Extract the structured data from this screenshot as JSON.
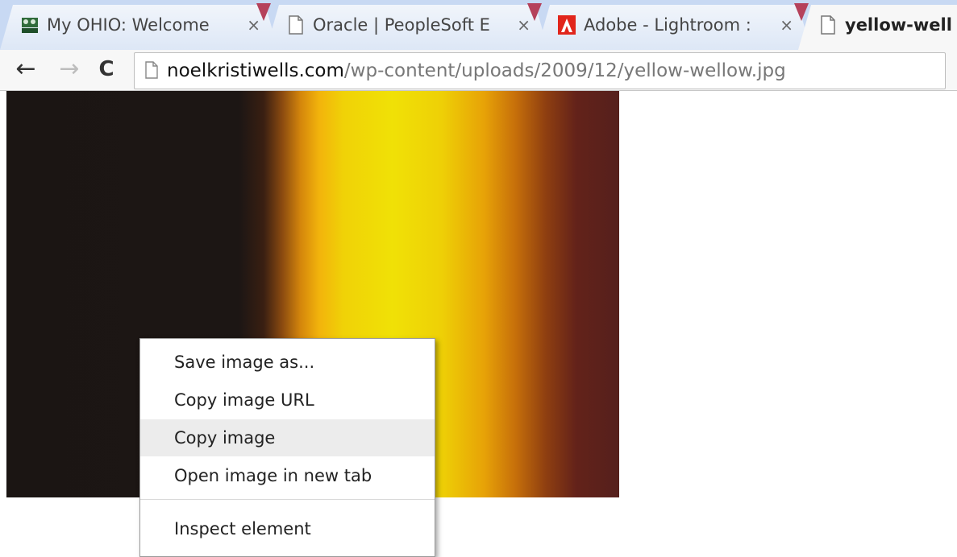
{
  "tabs": [
    {
      "title": "My OHIO: Welcome",
      "icon": "ohio-university-favicon",
      "active": false
    },
    {
      "title": "Oracle | PeopleSoft E",
      "icon": "document-icon",
      "active": false
    },
    {
      "title": "Adobe - Lightroom :",
      "icon": "adobe-icon",
      "active": false
    },
    {
      "title": "yellow-well",
      "icon": "document-icon",
      "active": true
    }
  ],
  "tab_close_glyph": "×",
  "toolbar": {
    "back_glyph": "←",
    "forward_glyph": "→",
    "reload_glyph": "C",
    "url_host": "noelkristiwells.com",
    "url_path": "/wp-content/uploads/2009/12/yellow-wellow.jpg"
  },
  "context_menu": {
    "items": [
      {
        "label": "Save image as..."
      },
      {
        "label": "Copy image URL"
      },
      {
        "label": "Copy image"
      },
      {
        "label": "Open image in new tab"
      },
      {
        "label": "Inspect element"
      }
    ],
    "highlighted_item": "Copy image"
  },
  "colors": {
    "tab_accent": "#b5415b",
    "adobe_red": "#e1251b",
    "image_yellow": "#f0e106",
    "image_dark": "#1b1513"
  }
}
